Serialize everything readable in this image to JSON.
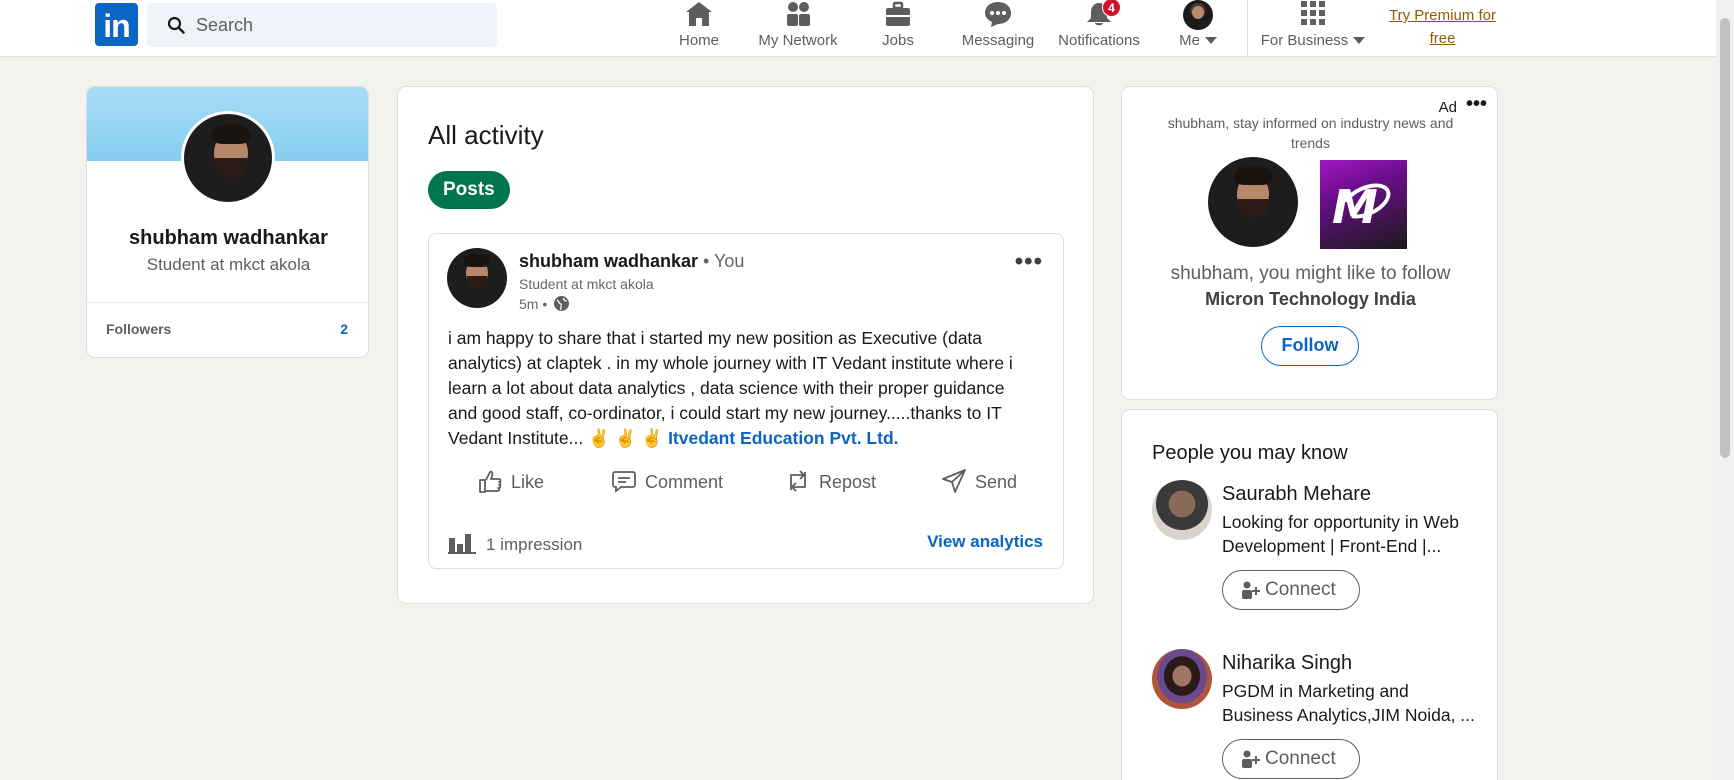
{
  "nav": {
    "logo_text": "in",
    "search_placeholder": "Search",
    "items": [
      {
        "label": "Home",
        "icon": "home-icon"
      },
      {
        "label": "My Network",
        "icon": "network-icon"
      },
      {
        "label": "Jobs",
        "icon": "briefcase-icon"
      },
      {
        "label": "Messaging",
        "icon": "messaging-icon"
      },
      {
        "label": "Notifications",
        "icon": "bell-icon",
        "badge": "4"
      },
      {
        "label": "Me",
        "icon": "avatar"
      },
      {
        "label": "For Business",
        "icon": "grid-icon"
      }
    ],
    "premium_line1": "Try Premium for",
    "premium_line2": "free"
  },
  "profile": {
    "name": "shubham wadhankar",
    "headline": "Student at mkct akola",
    "followers_label": "Followers",
    "followers_count": "2"
  },
  "activity": {
    "title": "All activity",
    "filter": "Posts",
    "post": {
      "author": "shubham wadhankar",
      "you_tag": " • You",
      "headline": "Student at mkct akola",
      "time": "5m •",
      "text": "i am happy to share that i started my new position as Executive (data analytics) at claptek . in my whole journey with IT Vedant institute where i learn a lot about data analytics , data science with their proper guidance and good staff, co-ordinator, i could start my new journey.....thanks to IT Vedant Institute... ✌️ ✌️ ✌️",
      "mention": "Itvedant Education Pvt. Ltd.",
      "actions": [
        "Like",
        "Comment",
        "Repost",
        "Send"
      ],
      "impressions": "1 impression",
      "analytics_link": "View analytics"
    }
  },
  "ad": {
    "label": "Ad",
    "tagline": "shubham, stay informed on industry news and trends",
    "follow_prompt": "shubham, you might like to follow",
    "company": "Micron Technology India",
    "follow_label": "Follow"
  },
  "pymk": {
    "title": "People you may know",
    "people": [
      {
        "name": "Saurabh Mehare",
        "headline": "Looking for opportunity in Web Development | Front-End |...",
        "action": "Connect"
      },
      {
        "name": "Niharika Singh",
        "headline": "PGDM in Marketing and Business Analytics,JIM Noida, ...",
        "action": "Connect"
      }
    ]
  },
  "colors": {
    "brand": "#0a66c2",
    "posts_pill": "#01754f",
    "badge": "#cb112d",
    "premium": "#915907",
    "page_bg": "#f4f2ee"
  }
}
